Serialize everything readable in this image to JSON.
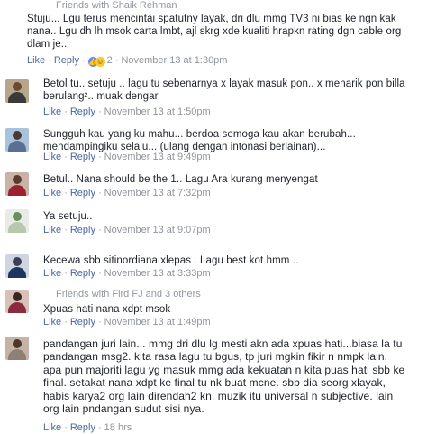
{
  "comments": [
    {
      "friends": "Friends with Shaik Rehman",
      "text": "Stuju... Lgu terus mencintai spatutny layak, dri dlu mmg TV3 ni bias ke ngn kak nana.. Lgu dh lh msok carta lmbt, ajl skrg xde kualiti hrapkn rating dgn cable org dlam je..",
      "like": "Like",
      "reply": "Reply",
      "reactions": "2",
      "time": "November 13 at 1:30pm"
    },
    {
      "text": "Betol tu.. setuju .. lagu tu sebenarnya x layak masuk pon.. x menarik pon billa berulang².. muak dengar",
      "like": "Like",
      "reply": "Reply",
      "time": "November 13 at 1:50pm"
    },
    {
      "text": "Sungguh kau yang ku mahu... berdoa semoga kau akan berubah... mendampingiku selalu... (ulang dengan intonasi berlainan)...",
      "like": "Like",
      "reply": "Reply",
      "time": "November 13 at 9:49pm"
    },
    {
      "text": "Betul.. Nana should be the 1.. Lagu Ara kurang menyengat",
      "like": "Like",
      "reply": "Reply",
      "time": "November 13 at 7:32pm"
    },
    {
      "text": "Ya setuju..",
      "like": "Like",
      "reply": "Reply",
      "time": "November 13 at 9:07pm"
    },
    {
      "text": "Kecewa sbb sitinordiana xlepas . Lagu best kot hmm ..",
      "like": "Like",
      "reply": "Reply",
      "time": "November 13 at 3:33pm"
    },
    {
      "friends": "Friends with Fird FJ and 3 others",
      "text": "Xpuas hati nana xdpt msok",
      "like": "Like",
      "reply": "Reply",
      "time": "November 13 at 1:49pm"
    },
    {
      "text": "pandangan juri lain... mmg dri dlu lg mesti akn ada xpuas hati...biasa la tu pandangan msg2. kita rasa lagu tu bgus, tp juri mgkin fikir n nmpk lain. apa pun majoriti lagu yg masuk mmg ada kekuatan n kita puas hati sbb ke final. setakat nana xdpt ke final tu nk buat mcne. sbb dia seorg xlayak, habis karya2 org lain direndah2 kn. muzik itu universal n subjective. lain org lain pndangan sudut sisi nya.",
      "like": "Like",
      "reply": "Reply",
      "time": "18 hrs"
    }
  ],
  "colors": {
    "link": "#4b67a1",
    "meta": "#90949c",
    "text": "#1d2129"
  },
  "icons": {
    "reaction_1": "like-reaction-icon",
    "reaction_2": "haha-reaction-icon"
  }
}
